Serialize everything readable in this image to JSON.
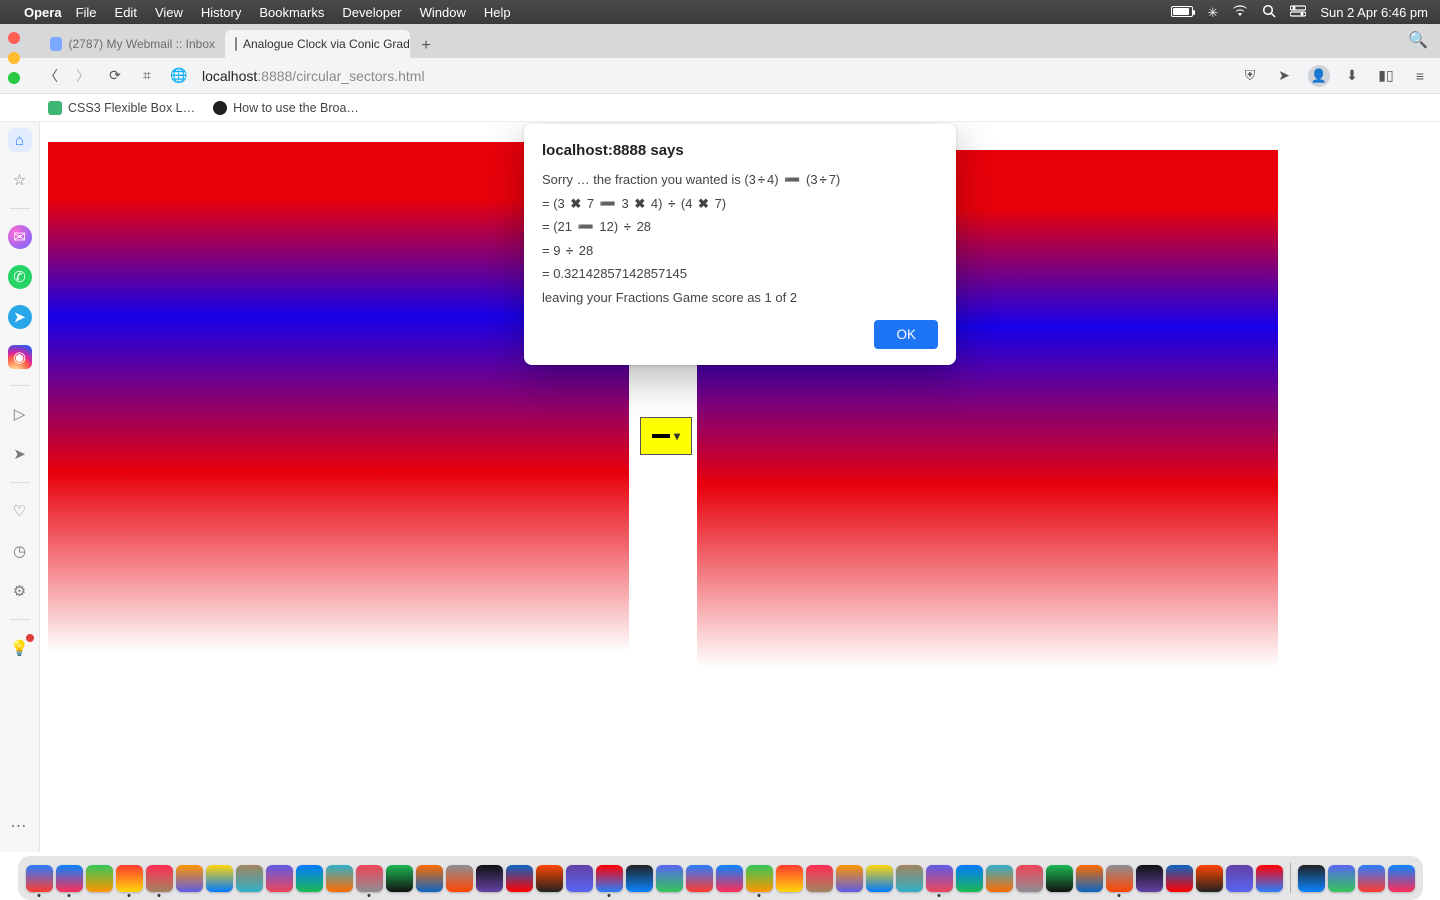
{
  "menubar": {
    "app": "Opera",
    "items": [
      "File",
      "Edit",
      "View",
      "History",
      "Bookmarks",
      "Developer",
      "Window",
      "Help"
    ],
    "clock": "Sun 2 Apr  6:46 pm"
  },
  "tabs": {
    "inactive": "(2787) My Webmail :: Inbox",
    "active": "Analogue Clock via Conic Gradi",
    "newtab": "+"
  },
  "address": {
    "host": "localhost",
    "port_path": ":8888/circular_sectors.html"
  },
  "bookmarks": {
    "b1": "CSS3 Flexible Box L…",
    "b2": "How to use the Broa…"
  },
  "op_select": {
    "value": "minus"
  },
  "alert": {
    "title": "localhost:8888 says",
    "line1_a": "Sorry … the fraction you wanted is (3",
    "line1_b": "4) ",
    "line1_c": " (3",
    "line1_d": "7)",
    "line2_a": "= (3 ",
    "line2_b": " 7 ",
    "line2_c": " 3 ",
    "line2_d": " 4) ",
    "line2_e": " (4 ",
    "line2_f": " 7)",
    "line3_a": "= (21 ",
    "line3_b": " 12) ",
    "line3_c": " 28",
    "line4_a": "= 9 ",
    "line4_b": " 28",
    "line5": "= 0.32142857142857145",
    "line6": "leaving your Fractions Game score as 1 of 2",
    "ok": "OK"
  },
  "ops": {
    "div": "÷",
    "mul": "✖",
    "sub": "➖"
  },
  "dock_count": 46
}
